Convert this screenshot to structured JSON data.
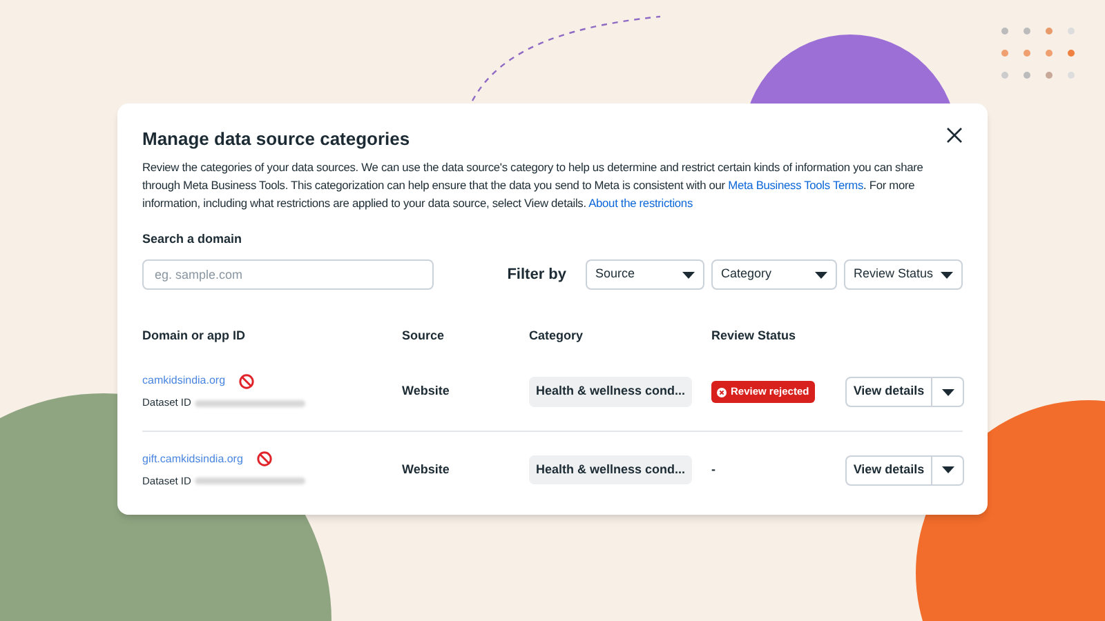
{
  "dialog": {
    "title": "Manage data source categories",
    "description": [
      {
        "kind": "text",
        "text": "Review the categories of your data sources. We can use the data source's category to help us determine and restrict certain kinds of information you can share through Meta Business Tools. This categorization can help ensure that the data you send to Meta is consistent with our "
      },
      {
        "kind": "link",
        "text": "Meta Business Tools Terms"
      },
      {
        "kind": "text",
        "text": ". For more information, including what restrictions are applied to your data source, select View details. "
      },
      {
        "kind": "link",
        "text": "About the restrictions"
      }
    ],
    "search": {
      "label": "Search a domain",
      "placeholder": "eg. sample.com"
    },
    "filter": {
      "label": "Filter by",
      "dropdowns": [
        "Source",
        "Category",
        "Review Status"
      ]
    },
    "table": {
      "columns": [
        "Domain or app ID",
        "Source",
        "Category",
        "Review Status"
      ],
      "rows": [
        {
          "domain": "camkidsindia.org",
          "dataset_label": "Dataset ID",
          "source": "Website",
          "category": "Health & wellness cond...",
          "status": {
            "kind": "badge",
            "text": "Review rejected"
          },
          "action": "View details"
        },
        {
          "domain": "gift.camkidsindia.org",
          "dataset_label": "Dataset ID",
          "source": "Website",
          "category": "Health & wellness cond...",
          "status": {
            "kind": "plain",
            "text": "-"
          },
          "action": "View details"
        }
      ]
    }
  }
}
